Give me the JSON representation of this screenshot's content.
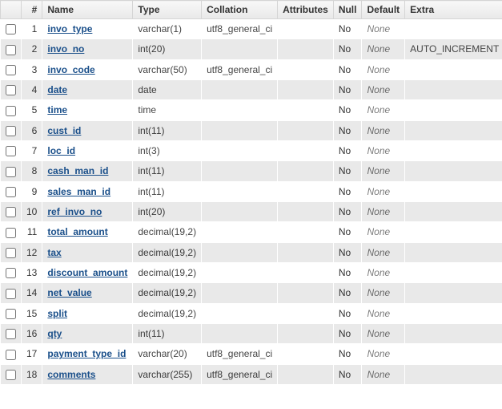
{
  "headers": {
    "check": "",
    "num": "#",
    "name": "Name",
    "type": "Type",
    "collation": "Collation",
    "attributes": "Attributes",
    "null": "Null",
    "default": "Default",
    "extra": "Extra"
  },
  "rows": [
    {
      "num": "1",
      "name": "invo_type",
      "key": false,
      "type": "varchar(1)",
      "collation": "utf8_general_ci",
      "attributes": "",
      "null": "No",
      "default": "None",
      "extra": ""
    },
    {
      "num": "2",
      "name": "invo_no",
      "key": true,
      "type": "int(20)",
      "collation": "",
      "attributes": "",
      "null": "No",
      "default": "None",
      "extra": "AUTO_INCREMENT"
    },
    {
      "num": "3",
      "name": "invo_code",
      "key": false,
      "type": "varchar(50)",
      "collation": "utf8_general_ci",
      "attributes": "",
      "null": "No",
      "default": "None",
      "extra": ""
    },
    {
      "num": "4",
      "name": "date",
      "key": false,
      "type": "date",
      "collation": "",
      "attributes": "",
      "null": "No",
      "default": "None",
      "extra": ""
    },
    {
      "num": "5",
      "name": "time",
      "key": false,
      "type": "time",
      "collation": "",
      "attributes": "",
      "null": "No",
      "default": "None",
      "extra": ""
    },
    {
      "num": "6",
      "name": "cust_id",
      "key": false,
      "type": "int(11)",
      "collation": "",
      "attributes": "",
      "null": "No",
      "default": "None",
      "extra": ""
    },
    {
      "num": "7",
      "name": "loc_id",
      "key": true,
      "type": "int(3)",
      "collation": "",
      "attributes": "",
      "null": "No",
      "default": "None",
      "extra": ""
    },
    {
      "num": "8",
      "name": "cash_man_id",
      "key": false,
      "type": "int(11)",
      "collation": "",
      "attributes": "",
      "null": "No",
      "default": "None",
      "extra": ""
    },
    {
      "num": "9",
      "name": "sales_man_id",
      "key": false,
      "type": "int(11)",
      "collation": "",
      "attributes": "",
      "null": "No",
      "default": "None",
      "extra": ""
    },
    {
      "num": "10",
      "name": "ref_invo_no",
      "key": false,
      "type": "int(20)",
      "collation": "",
      "attributes": "",
      "null": "No",
      "default": "None",
      "extra": ""
    },
    {
      "num": "11",
      "name": "total_amount",
      "key": false,
      "type": "decimal(19,2)",
      "collation": "",
      "attributes": "",
      "null": "No",
      "default": "None",
      "extra": ""
    },
    {
      "num": "12",
      "name": "tax",
      "key": false,
      "type": "decimal(19,2)",
      "collation": "",
      "attributes": "",
      "null": "No",
      "default": "None",
      "extra": ""
    },
    {
      "num": "13",
      "name": "discount_amount",
      "key": false,
      "type": "decimal(19,2)",
      "collation": "",
      "attributes": "",
      "null": "No",
      "default": "None",
      "extra": ""
    },
    {
      "num": "14",
      "name": "net_value",
      "key": false,
      "type": "decimal(19,2)",
      "collation": "",
      "attributes": "",
      "null": "No",
      "default": "None",
      "extra": ""
    },
    {
      "num": "15",
      "name": "split",
      "key": false,
      "type": "decimal(19,2)",
      "collation": "",
      "attributes": "",
      "null": "No",
      "default": "None",
      "extra": ""
    },
    {
      "num": "16",
      "name": "qty",
      "key": false,
      "type": "int(11)",
      "collation": "",
      "attributes": "",
      "null": "No",
      "default": "None",
      "extra": ""
    },
    {
      "num": "17",
      "name": "payment_type_id",
      "key": false,
      "type": "varchar(20)",
      "collation": "utf8_general_ci",
      "attributes": "",
      "null": "No",
      "default": "None",
      "extra": ""
    },
    {
      "num": "18",
      "name": "comments",
      "key": false,
      "type": "varchar(255)",
      "collation": "utf8_general_ci",
      "attributes": "",
      "null": "No",
      "default": "None",
      "extra": ""
    }
  ]
}
